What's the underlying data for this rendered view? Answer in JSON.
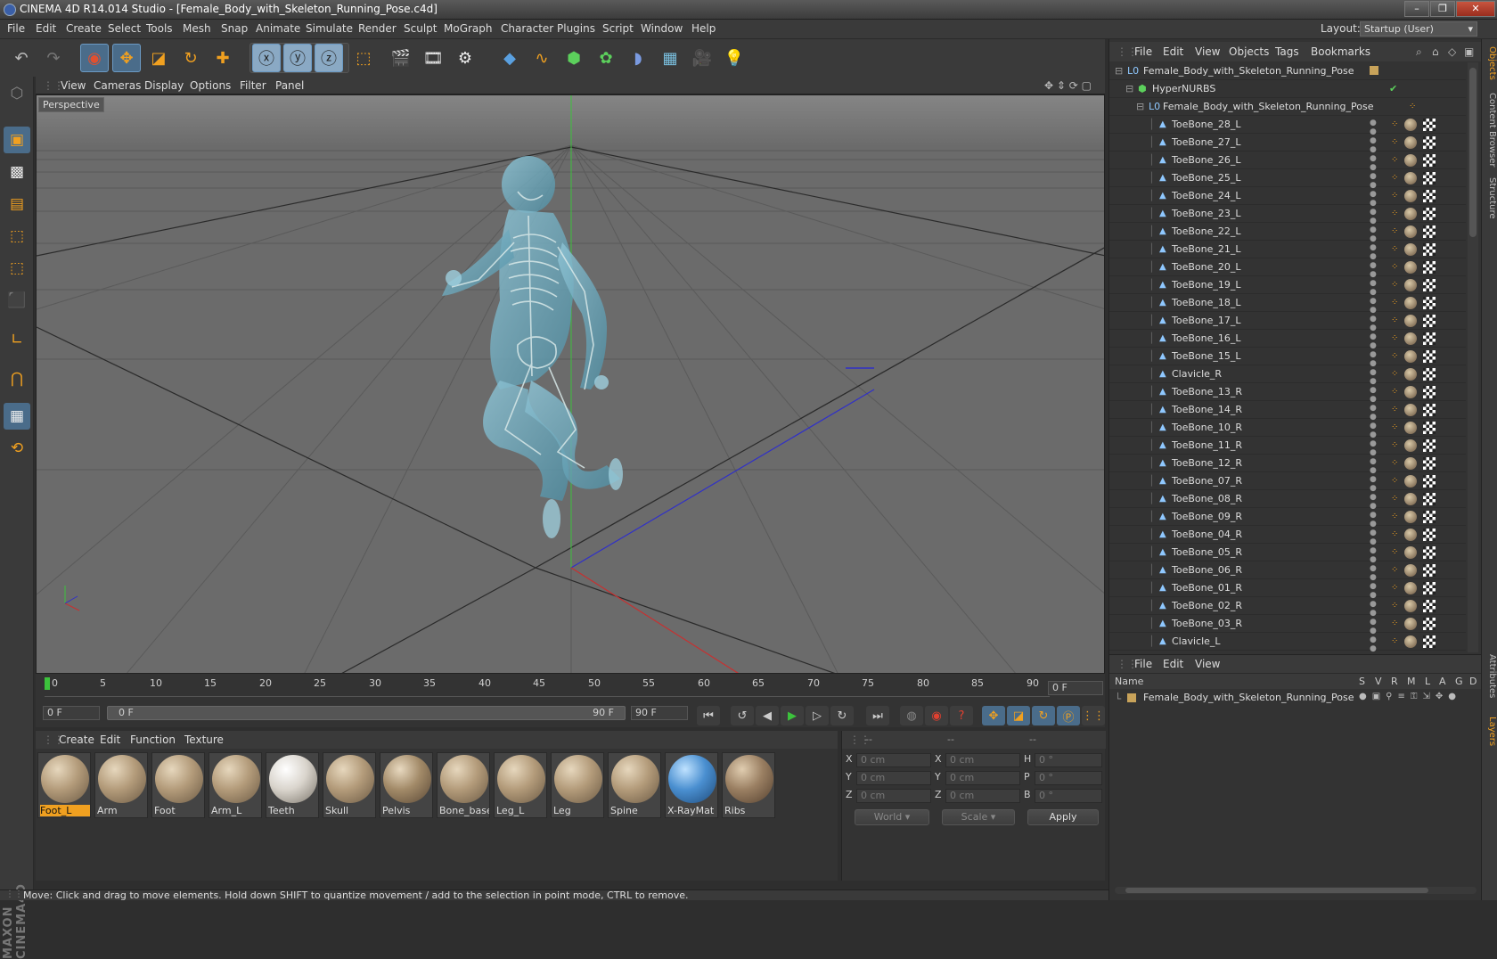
{
  "window": {
    "title": "CINEMA 4D R14.014 Studio - [Female_Body_with_Skeleton_Running_Pose.c4d]",
    "buttons": [
      "–",
      "❐",
      "✕"
    ]
  },
  "menu": [
    "File",
    "Edit",
    "Create",
    "Select",
    "Tools",
    "Mesh",
    "Snap",
    "Animate",
    "Simulate",
    "Render",
    "Sculpt",
    "MoGraph",
    "Character",
    "Plugins",
    "Script",
    "Window",
    "Help"
  ],
  "layout": {
    "label": "Layout:",
    "value": "Startup (User)"
  },
  "viewport": {
    "menu": [
      "View",
      "Cameras",
      "Display",
      "Options",
      "Filter",
      "Panel"
    ],
    "label": "Perspective"
  },
  "timeline": {
    "ticks": [
      "0",
      "5",
      "10",
      "15",
      "20",
      "25",
      "30",
      "35",
      "40",
      "45",
      "50",
      "55",
      "60",
      "65",
      "70",
      "75",
      "80",
      "85",
      "90"
    ],
    "current_frame": "0 F",
    "start_field": "0 F",
    "range_start": "0 F",
    "range_end": "90 F",
    "end_field": "90 F"
  },
  "materials": {
    "menu": [
      "Create",
      "Edit",
      "Function",
      "Texture"
    ],
    "items": [
      "Foot_L",
      "Arm",
      "Foot",
      "Arm_L",
      "Teeth",
      "Skull",
      "Pelvis",
      "Bone_base",
      "Leg_L",
      "Leg",
      "Spine",
      "X-RayMat",
      "Ribs"
    ]
  },
  "coords": {
    "headers": [
      "--",
      "--",
      "--"
    ],
    "rows": [
      {
        "a": "X",
        "av": "0 cm",
        "b": "X",
        "bv": "0 cm",
        "c": "H",
        "cv": "0 °"
      },
      {
        "a": "Y",
        "av": "0 cm",
        "b": "Y",
        "bv": "0 cm",
        "c": "P",
        "cv": "0 °"
      },
      {
        "a": "Z",
        "av": "0 cm",
        "b": "Z",
        "bv": "0 cm",
        "c": "B",
        "cv": "0 °"
      }
    ],
    "world": "World",
    "scale": "Scale",
    "apply": "Apply"
  },
  "status": "Move: Click and drag to move elements. Hold down SHIFT to quantize movement / add to the selection in point mode, CTRL to remove.",
  "objects": {
    "menu": [
      "File",
      "Edit",
      "View",
      "Objects",
      "Tags",
      "Bookmarks"
    ],
    "root": "Female_Body_with_Skeleton_Running_Pose",
    "nurbs": "HyperNURBS",
    "child": "Female_Body_with_Skeleton_Running_Pose",
    "bones": [
      "ToeBone_28_L",
      "ToeBone_27_L",
      "ToeBone_26_L",
      "ToeBone_25_L",
      "ToeBone_24_L",
      "ToeBone_23_L",
      "ToeBone_22_L",
      "ToeBone_21_L",
      "ToeBone_20_L",
      "ToeBone_19_L",
      "ToeBone_18_L",
      "ToeBone_17_L",
      "ToeBone_16_L",
      "ToeBone_15_L",
      "Clavicle_R",
      "ToeBone_13_R",
      "ToeBone_14_R",
      "ToeBone_10_R",
      "ToeBone_11_R",
      "ToeBone_12_R",
      "ToeBone_07_R",
      "ToeBone_08_R",
      "ToeBone_09_R",
      "ToeBone_04_R",
      "ToeBone_05_R",
      "ToeBone_06_R",
      "ToeBone_01_R",
      "ToeBone_02_R",
      "ToeBone_03_R",
      "Clavicle_L"
    ]
  },
  "layers": {
    "menu": [
      "File",
      "Edit",
      "View"
    ],
    "columns": [
      "Name",
      "S",
      "V",
      "R",
      "M",
      "L",
      "A",
      "G",
      "D"
    ],
    "row": "Female_Body_with_Skeleton_Running_Pose"
  },
  "side_tabs": [
    "Objects",
    "Content Browser",
    "Structure",
    "Attributes",
    "Layers"
  ]
}
